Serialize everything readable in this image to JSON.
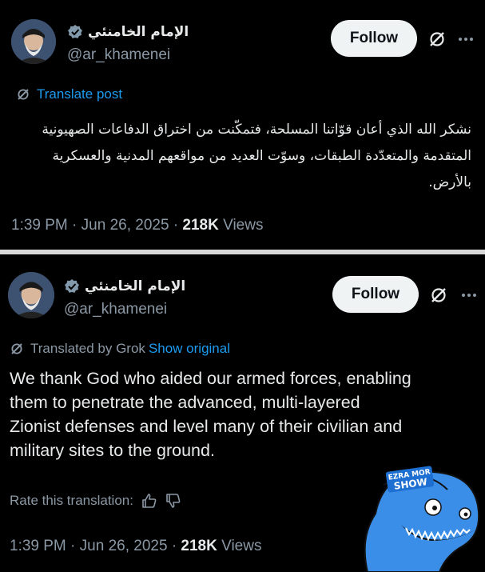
{
  "top_post": {
    "author_name": "الإمام الخامنئي",
    "handle": "@ar_khamenei",
    "follow_label": "Follow",
    "translate_label": "Translate post",
    "body_lines": [
      "نشكر الله الذي أعان قوّاتنا المسلحة، فتمكّنت من اختراق الدفاعات الصهيونية",
      "المتقدمة والمتعدّدة الطبقات، وسوّت العديد من مواقعهم المدنية والعسكرية",
      "بالأرض."
    ],
    "time": "1:39 PM",
    "date": "Jun 26, 2025",
    "views_count": "218K",
    "views_label": "Views"
  },
  "bottom_post": {
    "author_name": "الإمام الخامنئي",
    "handle": "@ar_khamenei",
    "follow_label": "Follow",
    "translated_by": "Translated by Grok",
    "show_original": "Show original",
    "body_lines": [
      "We thank God who aided our armed forces, enabling",
      "them to penetrate the advanced, multi-layered",
      "Zionist defenses and level many of their civilian and",
      "military sites to the ground."
    ],
    "rate_label": "Rate this translation:",
    "time": "1:39 PM",
    "date": "Jun 26, 2025",
    "views_count": "218K",
    "views_label": "Views"
  },
  "sticker": {
    "line1": "EZRA MOR",
    "line2": "SHOW"
  },
  "colors": {
    "background": "#000000",
    "link": "#1d9bf0",
    "muted": "#8b98a5",
    "text": "#e7e9ea",
    "sticker_blue": "#3b8ee8"
  },
  "icons": [
    "verified-badge-icon",
    "grok-icon",
    "more-icon",
    "thumbs-up-icon",
    "thumbs-down-icon"
  ]
}
